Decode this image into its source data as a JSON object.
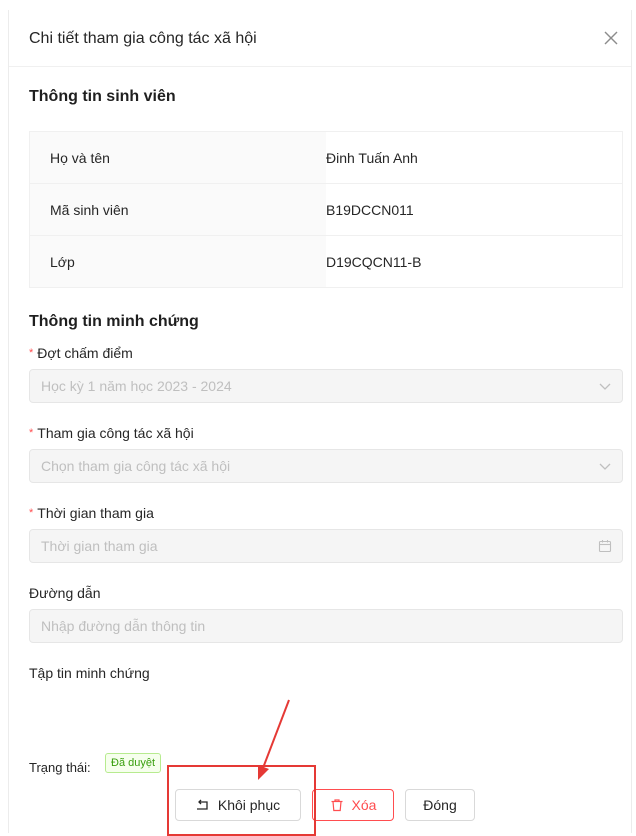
{
  "modal": {
    "title": "Chi tiết tham gia công tác xã hội",
    "close_icon": "close-icon"
  },
  "student_info": {
    "section_title": "Thông tin sinh viên",
    "rows": [
      {
        "label": "Họ và tên",
        "value": "Đinh Tuấn Anh"
      },
      {
        "label": "Mã sinh viên",
        "value": "B19DCCN011"
      },
      {
        "label": "Lớp",
        "value": "D19CQCN11-B"
      }
    ]
  },
  "evidence": {
    "section_title": "Thông tin minh chứng",
    "period": {
      "label": "Đợt chấm điểm",
      "value": "Học kỳ 1 năm học 2023 - 2024",
      "icon": "chevron-down-icon"
    },
    "activity": {
      "label": "Tham gia công tác xã hội",
      "placeholder": "Chọn tham gia công tác xã hội",
      "icon": "chevron-down-icon"
    },
    "time": {
      "label": "Thời gian tham gia",
      "placeholder": "Thời gian tham gia",
      "icon": "calendar-icon"
    },
    "link": {
      "label": "Đường dẫn",
      "placeholder": "Nhập đường dẫn thông tin"
    },
    "files": {
      "label": "Tập tin minh chứng"
    }
  },
  "status": {
    "label": "Trạng thái:",
    "badge": "Đã duyệt",
    "badge_color": "#389e0d"
  },
  "footer": {
    "restore_label": "Khôi phục",
    "delete_label": "Xóa",
    "close_label": "Đóng",
    "delete_color": "#ff4d4f"
  },
  "annotation": {
    "color": "#e53935"
  }
}
